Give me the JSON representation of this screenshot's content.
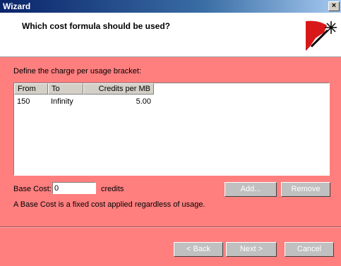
{
  "window": {
    "title": "Wizard",
    "close_glyph": "×"
  },
  "header": {
    "heading": "Which cost formula should be used?",
    "icon": "magic-wand-icon"
  },
  "main": {
    "define_label": "Define the charge per usage bracket:",
    "columns": [
      "From",
      "To",
      "Credits per MB"
    ],
    "rows": [
      {
        "from": "150",
        "to": "Infinity",
        "credits": "5.00"
      }
    ],
    "base_cost_label": "Base Cost:",
    "base_cost_value": "0",
    "credits_label": "credits",
    "add_label": "Add...",
    "remove_label": "Remove",
    "note": "A Base Cost is a fixed cost applied regardless of usage."
  },
  "footer": {
    "back_label": "< Back",
    "next_label": "Next >",
    "cancel_label": "Cancel"
  },
  "colors": {
    "panel": "#ff7f7f",
    "titlebar": "#0a246a"
  }
}
